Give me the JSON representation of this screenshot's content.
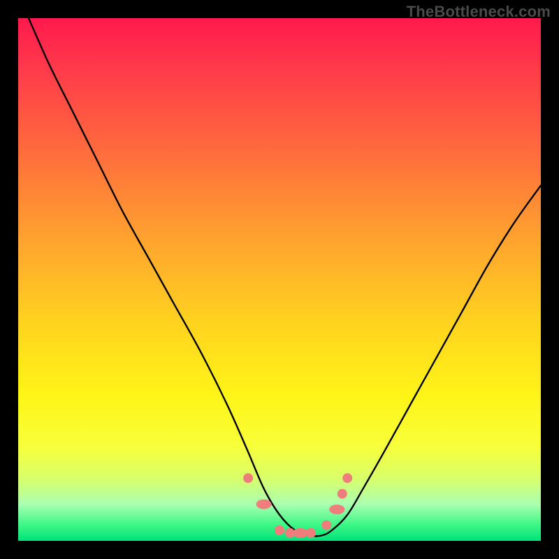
{
  "watermark": "TheBottleneck.com",
  "chart_data": {
    "type": "line",
    "title": "",
    "xlabel": "",
    "ylabel": "",
    "xlim": [
      0,
      100
    ],
    "ylim": [
      0,
      100
    ],
    "grid": false,
    "legend": false,
    "annotations": [],
    "series": [
      {
        "name": "curve",
        "color": "#000000",
        "x": [
          2,
          6,
          10,
          15,
          20,
          25,
          30,
          35,
          40,
          44,
          47,
          50,
          53,
          56,
          58,
          60,
          63,
          66,
          70,
          75,
          80,
          85,
          90,
          95,
          100
        ],
        "y": [
          100,
          91,
          83,
          73,
          63,
          54,
          45,
          36,
          26,
          17,
          10,
          5,
          2,
          1,
          1,
          2,
          5,
          10,
          17,
          26,
          35,
          44,
          53,
          61,
          68
        ]
      },
      {
        "name": "markers",
        "color": "#ee7d7c",
        "type": "scatter",
        "x": [
          44,
          47,
          50,
          52,
          54,
          56,
          59,
          61,
          62,
          63
        ],
        "y": [
          12,
          7,
          2,
          1.5,
          1.5,
          1.5,
          3,
          6,
          9,
          12
        ]
      }
    ],
    "background_gradient": {
      "direction": "vertical",
      "stops": [
        {
          "pos": 0,
          "color": "#ff1a4d"
        },
        {
          "pos": 10,
          "color": "#ff3b4a"
        },
        {
          "pos": 25,
          "color": "#ff6a3d"
        },
        {
          "pos": 42,
          "color": "#ffa22f"
        },
        {
          "pos": 58,
          "color": "#ffd21f"
        },
        {
          "pos": 72,
          "color": "#fff417"
        },
        {
          "pos": 82,
          "color": "#f7ff3a"
        },
        {
          "pos": 88,
          "color": "#d9ff6a"
        },
        {
          "pos": 93,
          "color": "#aaffb0"
        },
        {
          "pos": 97,
          "color": "#3cf785"
        },
        {
          "pos": 100,
          "color": "#00e27a"
        }
      ]
    }
  }
}
